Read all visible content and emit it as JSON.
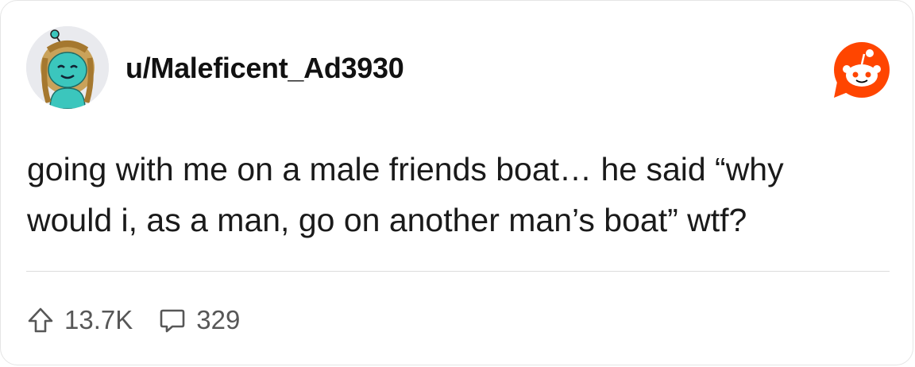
{
  "post": {
    "username": "u/Maleficent_Ad3930",
    "body_line1": "going with me on a male friends boat… he said “why",
    "body_line2": "would i, as a man, go on another man’s boat” wtf?"
  },
  "stats": {
    "upvotes": "13.7K",
    "comments": "329"
  },
  "icons": {
    "avatar": "snoo-avatar",
    "brand": "reddit-logo-icon",
    "upvote": "upvote-arrow-icon",
    "comment": "comment-bubble-icon"
  },
  "colors": {
    "brand": "#ff4500",
    "avatar_body": "#3bc6bd",
    "avatar_bg": "#e9eaee"
  }
}
